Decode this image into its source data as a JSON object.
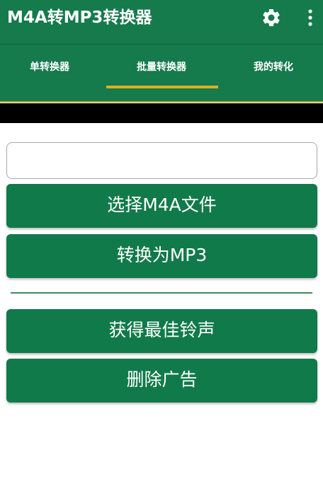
{
  "app_bar": {
    "title": "M4A转MP3转换器",
    "icons": [
      "gear-icon",
      "more-vert-icon"
    ]
  },
  "tabs": [
    {
      "label": "单转换器",
      "selected": false
    },
    {
      "label": "批量转换器",
      "selected": true
    },
    {
      "label": "我的转化",
      "selected": false
    }
  ],
  "main": {
    "file_input": {
      "value": "",
      "placeholder": ""
    },
    "buttons": {
      "select_file": "选择M4A文件",
      "convert": "转换为MP3",
      "best_ringtones": "获得最佳铃声",
      "remove_ads": "删除广告"
    }
  },
  "colors": {
    "primary_green": "#157a4c",
    "button_green": "#117a4a",
    "tab_indicator": "#d9b21c"
  }
}
